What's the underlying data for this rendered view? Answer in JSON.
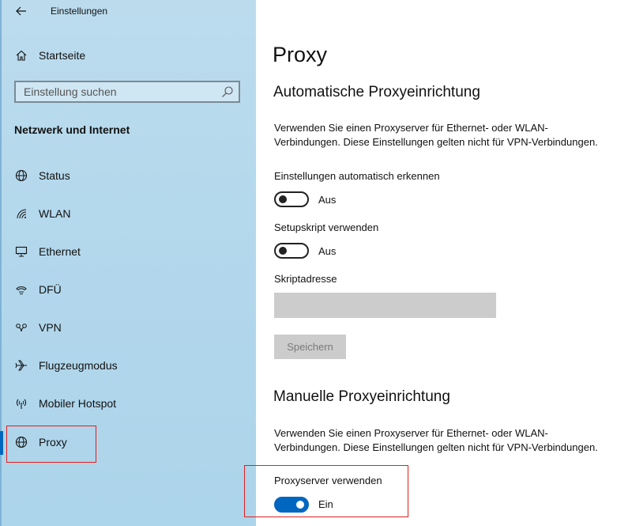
{
  "window": {
    "title": "Einstellungen"
  },
  "sidebar": {
    "home_label": "Startseite",
    "search": {
      "placeholder": "Einstellung suchen"
    },
    "section_heading": "Netzwerk und Internet",
    "items": [
      {
        "label": "Status",
        "icon": "globe-status-icon"
      },
      {
        "label": "WLAN",
        "icon": "wifi-icon"
      },
      {
        "label": "Ethernet",
        "icon": "ethernet-icon"
      },
      {
        "label": "DFÜ",
        "icon": "dialup-icon"
      },
      {
        "label": "VPN",
        "icon": "vpn-icon"
      },
      {
        "label": "Flugzeugmodus",
        "icon": "airplane-icon"
      },
      {
        "label": "Mobiler Hotspot",
        "icon": "hotspot-icon"
      },
      {
        "label": "Proxy",
        "icon": "globe-icon",
        "selected": true
      }
    ]
  },
  "main": {
    "title": "Proxy",
    "auto": {
      "heading": "Automatische Proxyeinrichtung",
      "description_line1": "Verwenden Sie einen Proxyserver für Ethernet- oder WLAN-",
      "description_line2": "Verbindungen. Diese Einstellungen gelten nicht für VPN-Verbindungen.",
      "detect": {
        "label": "Einstellungen automatisch erkennen",
        "state": "Aus",
        "on": false
      },
      "script": {
        "label": "Setupskript verwenden",
        "state": "Aus",
        "on": false
      },
      "script_address": {
        "label": "Skriptadresse",
        "value": ""
      },
      "save_label": "Speichern"
    },
    "manual": {
      "heading": "Manuelle Proxyeinrichtung",
      "description_line1": "Verwenden Sie einen Proxyserver für Ethernet- oder WLAN-",
      "description_line2": "Verbindungen. Diese Einstellungen gelten nicht für VPN-Verbindungen.",
      "use_proxy": {
        "label": "Proxyserver verwenden",
        "state": "Ein",
        "on": true
      }
    }
  },
  "colors": {
    "accent": "#0067c0",
    "sidebar_bg": "#b4d8ec",
    "highlight": "#e02020",
    "disabled_bg": "#cccccc"
  }
}
